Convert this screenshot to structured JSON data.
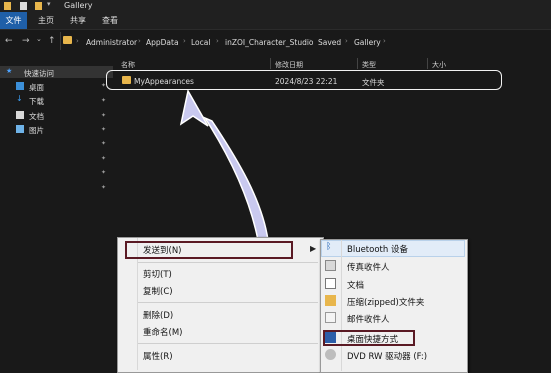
{
  "window": {
    "title": "Gallery"
  },
  "ribbon": {
    "tabs": [
      "文件",
      "主页",
      "共享",
      "查看"
    ]
  },
  "address": {
    "crumbs": [
      "Administrator",
      "AppData",
      "Local",
      "inZOI_Character_Studio",
      "Saved",
      "Gallery"
    ],
    "separator": "›"
  },
  "nav": {
    "back": "←",
    "forward": "→",
    "recent": "⌄",
    "up": "↑",
    "items": [
      {
        "label": "快速访问"
      },
      {
        "label": "桌面"
      },
      {
        "label": "下载"
      },
      {
        "label": "文档"
      },
      {
        "label": "图片"
      }
    ]
  },
  "columns": {
    "name": "名称",
    "modified": "修改日期",
    "type": "类型",
    "size": "大小"
  },
  "files": [
    {
      "name": "MyAppearances",
      "modified": "2024/8/23 22:21",
      "type": "文件夹",
      "size": ""
    }
  ],
  "context_menu": {
    "items": [
      "发送到(N)",
      "剪切(T)",
      "复制(C)",
      "删除(D)",
      "重命名(M)",
      "属性(R)"
    ]
  },
  "sendto_menu": {
    "items": [
      "Bluetooth 设备",
      "传真收件人",
      "文档",
      "压缩(zipped)文件夹",
      "邮件收件人",
      "桌面快捷方式",
      "DVD RW 驱动器 (F:)"
    ]
  },
  "colors": {
    "accent": "#1f5fa8",
    "folder": "#e8b64c",
    "highlight_box": "#5a1a24",
    "arrow": "#c9c9ef"
  }
}
